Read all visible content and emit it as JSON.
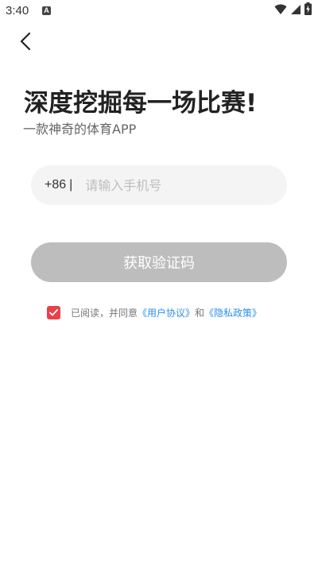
{
  "status_bar": {
    "time": "3:40",
    "notification_icon": "A"
  },
  "header": {
    "back_icon": "chevron-left-icon"
  },
  "login": {
    "headline": "深度挖掘每一场比赛!",
    "subtitle": "一款神奇的体育APP",
    "country_code": "+86",
    "separator": "|",
    "phone_placeholder": "请输入手机号",
    "phone_value": "",
    "get_code_label": "获取验证码"
  },
  "agreement": {
    "checked": true,
    "prefix": "已阅读，并同意",
    "user_agreement": "《用户协议》",
    "and": "和",
    "privacy_policy": "《隐私政策》"
  },
  "colors": {
    "accent_red": "#e8414a",
    "link_blue": "#2b8fe8",
    "button_disabled": "#bdbdbd",
    "input_bg": "#f4f4f4"
  }
}
